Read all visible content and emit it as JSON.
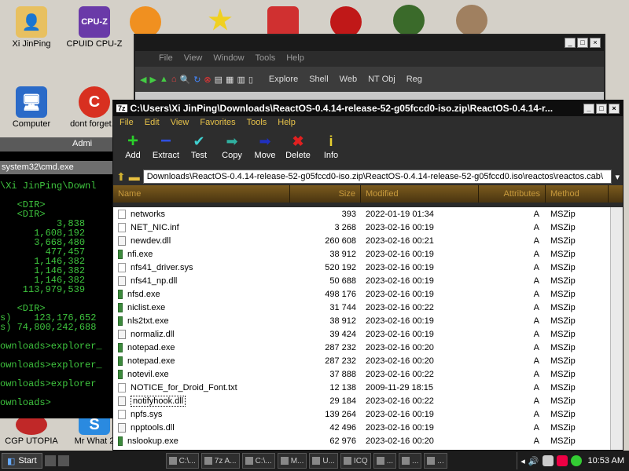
{
  "desktop": {
    "icons": [
      {
        "label": "Xi JinPing"
      },
      {
        "label": "CPUID CPU-Z"
      },
      {
        "label": "Computer"
      },
      {
        "label": "dont forget..."
      },
      {
        "label": "CGP UTOPIA"
      },
      {
        "label": "Mr What 2"
      }
    ]
  },
  "cmd": {
    "title_tab": "Admi",
    "title": "system32\\cmd.exe",
    "lines": [
      "\\Xi JinPing\\Downl",
      "",
      "   <DIR>",
      "   <DIR>",
      "          3,838",
      "      1,608,192",
      "      3,668,480",
      "        477,457",
      "      1,146,382",
      "      1,146,382",
      "      1,146,382",
      "    113,979,539",
      "",
      "   <DIR>",
      "s)    123,176,652",
      "s) 74,800,242,688",
      "",
      "ownloads>explorer_",
      "",
      "ownloads>explorer_",
      "",
      "ownloads>explorer",
      "",
      "ownloads>"
    ]
  },
  "explorer": {
    "menu": [
      "File",
      "View",
      "Window",
      "Tools",
      "Help"
    ],
    "tools": [
      "Explore",
      "Shell",
      "Web",
      "NT Obj",
      "Reg"
    ]
  },
  "zip": {
    "title": "C:\\Users\\Xi JinPing\\Downloads\\ReactOS-0.4.14-release-52-g05fccd0-iso.zip\\ReactOS-0.4.14-r...",
    "menu": [
      "File",
      "Edit",
      "View",
      "Favorites",
      "Tools",
      "Help"
    ],
    "toolbar": [
      {
        "label": "Add",
        "icon": "plus-icon"
      },
      {
        "label": "Extract",
        "icon": "minus-icon"
      },
      {
        "label": "Test",
        "icon": "check-icon"
      },
      {
        "label": "Copy",
        "icon": "copy-arrow-icon"
      },
      {
        "label": "Move",
        "icon": "move-arrow-icon"
      },
      {
        "label": "Delete",
        "icon": "delete-x-icon"
      },
      {
        "label": "Info",
        "icon": "info-icon"
      }
    ],
    "path": "Downloads\\ReactOS-0.4.14-release-52-g05fccd0-iso.zip\\ReactOS-0.4.14-release-52-g05fccd0.iso\\reactos\\reactos.cab\\",
    "columns": [
      "Name",
      "Size",
      "Modified",
      "Attributes",
      "Method"
    ],
    "rows": [
      {
        "name": "networks",
        "size": "393",
        "modified": "2022-01-19 01:34",
        "attr": "A",
        "method": "MSZip",
        "kind": "file"
      },
      {
        "name": "NET_NIC.inf",
        "size": "3 268",
        "modified": "2023-02-16 00:19",
        "attr": "A",
        "method": "MSZip",
        "kind": "inf"
      },
      {
        "name": "newdev.dll",
        "size": "260 608",
        "modified": "2023-02-16 00:21",
        "attr": "A",
        "method": "MSZip",
        "kind": "dll"
      },
      {
        "name": "nfi.exe",
        "size": "38 912",
        "modified": "2023-02-16 00:19",
        "attr": "A",
        "method": "MSZip",
        "kind": "exe"
      },
      {
        "name": "nfs41_driver.sys",
        "size": "520 192",
        "modified": "2023-02-16 00:19",
        "attr": "A",
        "method": "MSZip",
        "kind": "file"
      },
      {
        "name": "nfs41_np.dll",
        "size": "50 688",
        "modified": "2023-02-16 00:19",
        "attr": "A",
        "method": "MSZip",
        "kind": "dll"
      },
      {
        "name": "nfsd.exe",
        "size": "498 176",
        "modified": "2023-02-16 00:19",
        "attr": "A",
        "method": "MSZip",
        "kind": "exe"
      },
      {
        "name": "niclist.exe",
        "size": "31 744",
        "modified": "2023-02-16 00:22",
        "attr": "A",
        "method": "MSZip",
        "kind": "exe"
      },
      {
        "name": "nls2txt.exe",
        "size": "38 912",
        "modified": "2023-02-16 00:19",
        "attr": "A",
        "method": "MSZip",
        "kind": "exe"
      },
      {
        "name": "normaliz.dll",
        "size": "39 424",
        "modified": "2023-02-16 00:19",
        "attr": "A",
        "method": "MSZip",
        "kind": "dll"
      },
      {
        "name": "notepad.exe",
        "size": "287 232",
        "modified": "2023-02-16 00:20",
        "attr": "A",
        "method": "MSZip",
        "kind": "exe"
      },
      {
        "name": "notepad.exe",
        "size": "287 232",
        "modified": "2023-02-16 00:20",
        "attr": "A",
        "method": "MSZip",
        "kind": "exe"
      },
      {
        "name": "notevil.exe",
        "size": "37 888",
        "modified": "2023-02-16 00:22",
        "attr": "A",
        "method": "MSZip",
        "kind": "exe"
      },
      {
        "name": "NOTICE_for_Droid_Font.txt",
        "size": "12 138",
        "modified": "2009-11-29 18:15",
        "attr": "A",
        "method": "MSZip",
        "kind": "file"
      },
      {
        "name": "notifyhook.dll",
        "size": "29 184",
        "modified": "2023-02-16 00:22",
        "attr": "A",
        "method": "MSZip",
        "kind": "dll",
        "selected": true
      },
      {
        "name": "npfs.sys",
        "size": "139 264",
        "modified": "2023-02-16 00:19",
        "attr": "A",
        "method": "MSZip",
        "kind": "file"
      },
      {
        "name": "npptools.dll",
        "size": "42 496",
        "modified": "2023-02-16 00:19",
        "attr": "A",
        "method": "MSZip",
        "kind": "dll"
      },
      {
        "name": "nslookup.exe",
        "size": "62 976",
        "modified": "2023-02-16 00:20",
        "attr": "A",
        "method": "MSZip",
        "kind": "exe"
      }
    ]
  },
  "taskbar": {
    "start": "Start",
    "tasks": [
      "C:\\...",
      "7z A...",
      "C:\\...",
      "M...",
      "U...",
      "ICQ",
      "...",
      "...",
      "..."
    ],
    "clock": "10:53 AM"
  },
  "colors": {
    "cmd_text": "#3ec43e",
    "zip_menu": "#e8c34a",
    "header_gold": "#c89a3c"
  }
}
